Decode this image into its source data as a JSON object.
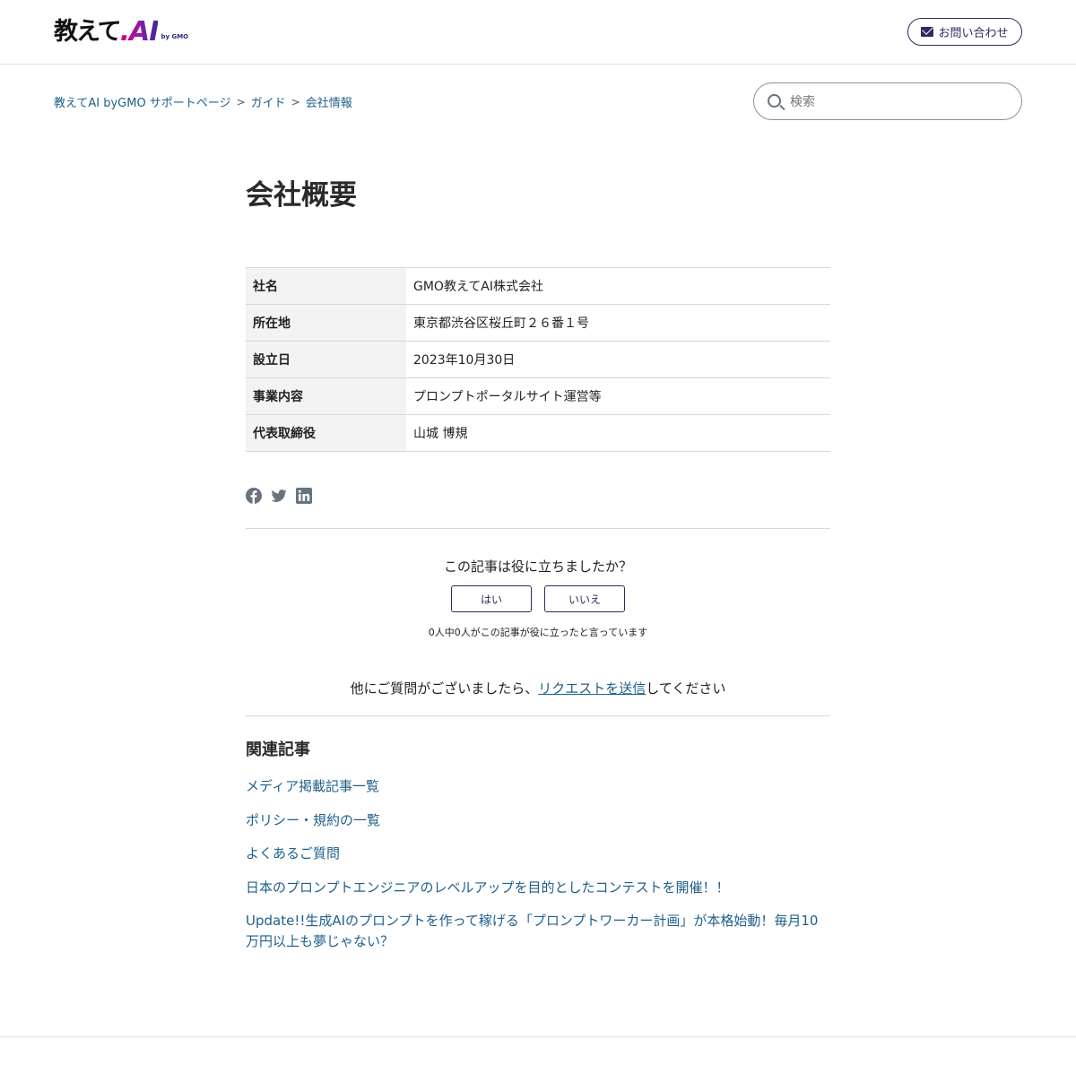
{
  "header": {
    "logo_text_jp": "教えて",
    "logo_text_ai": ".AI",
    "logo_by": "by GMO",
    "contact_label": "お問い合わせ"
  },
  "breadcrumb": {
    "items": [
      "教えてAI byGMO サポートページ",
      "ガイド",
      "会社情報"
    ],
    "separator": ">"
  },
  "search": {
    "placeholder": "検索"
  },
  "article": {
    "title": "会社概要",
    "table": [
      {
        "label": "社名",
        "value": "GMO教えてAI株式会社"
      },
      {
        "label": "所在地",
        "value": "東京都渋谷区桜丘町２６番１号"
      },
      {
        "label": "設立日",
        "value": "2023年10月30日"
      },
      {
        "label": "事業内容",
        "value": "プロンプトポータルサイト運営等"
      },
      {
        "label": "代表取締役",
        "value": "山城 博規"
      }
    ]
  },
  "share": {
    "icons": [
      "facebook-icon",
      "twitter-icon",
      "linkedin-icon"
    ]
  },
  "vote": {
    "question": "この記事は役に立ちましたか？",
    "yes_label": "はい",
    "no_label": "いいえ",
    "count_text": "0人中0人がこの記事が役に立ったと言っています"
  },
  "request": {
    "prefix": "他にご質問がございましたら、",
    "link_text": "リクエストを送信",
    "suffix": "してください"
  },
  "related": {
    "title": "関連記事",
    "items": [
      "メディア掲載記事一覧",
      "ポリシー・規約の一覧",
      "よくあるご質問",
      "日本のプロンプトエンジニアのレベルアップを目的としたコンテストを開催！！",
      "Update!!生成AIのプロンプトを作って稼げる「プロンプトワーカー計画」が本格始動！毎月10万円以上も夢じゃない？"
    ]
  },
  "colors": {
    "link": "#1f5f8b",
    "brand_navy": "#2b2b5e",
    "brand_magenta": "#e4007f"
  }
}
